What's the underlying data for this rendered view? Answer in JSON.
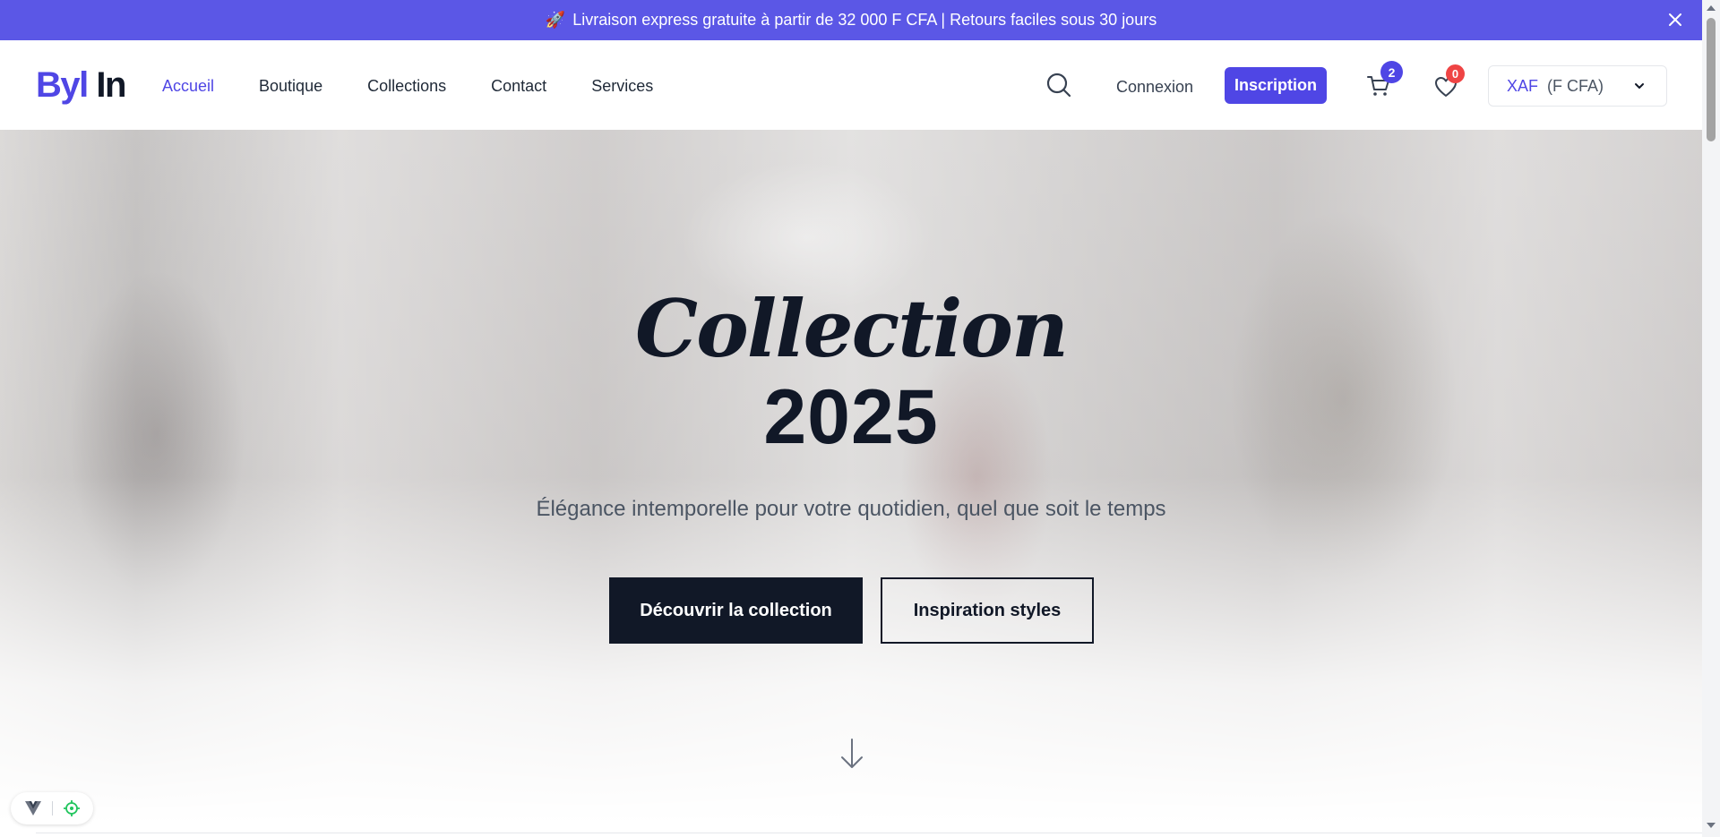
{
  "announcement": {
    "text": "Livraison express gratuite à partir de 32 000 F CFA | Retours faciles sous 30 jours",
    "icon": "rocket-icon"
  },
  "header": {
    "logo_part1": "Byl",
    "logo_part2": "In",
    "nav": [
      {
        "label": "Accueil",
        "active": true
      },
      {
        "label": "Boutique",
        "active": false
      },
      {
        "label": "Collections",
        "active": false
      },
      {
        "label": "Contact",
        "active": false
      },
      {
        "label": "Services",
        "active": false
      }
    ],
    "login_label": "Connexion",
    "signup_label": "Inscription",
    "cart_count": "2",
    "wishlist_count": "0",
    "currency_code": "XAF",
    "currency_symbol": "(F CFA)"
  },
  "hero": {
    "title": "Collection",
    "year": "2025",
    "subtitle": "Élégance intemporelle pour votre quotidien, quel que soit le temps",
    "primary_cta": "Découvrir la collection",
    "secondary_cta": "Inspiration styles"
  },
  "colors": {
    "accent": "#4f46e5",
    "announcement_bg": "#5b57e6",
    "dark": "#111827",
    "badge_red": "#ef4444"
  }
}
